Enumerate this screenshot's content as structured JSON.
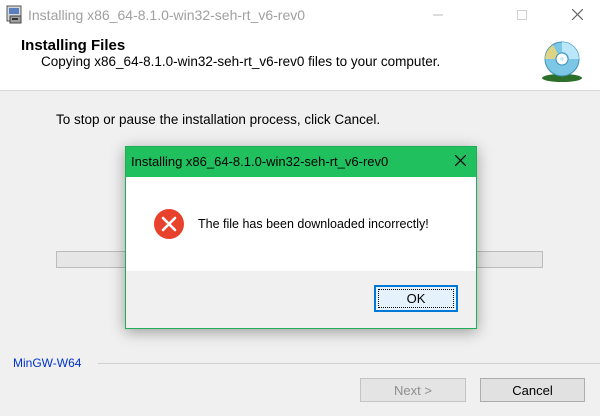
{
  "window": {
    "title": "Installing x86_64-8.1.0-win32-seh-rt_v6-rev0",
    "minimize_icon": "minimize-icon",
    "maximize_icon": "maximize-icon",
    "close_icon": "close-icon"
  },
  "header": {
    "title": "Installing Files",
    "subtitle": "Copying x86_64-8.1.0-win32-seh-rt_v6-rev0 files to your computer.",
    "icon": "install-disc-icon"
  },
  "main": {
    "instruction": "To stop or pause the installation process, click Cancel.",
    "progress": 0
  },
  "footer": {
    "brand": "MinGW-W64",
    "next_label": "Next >",
    "cancel_label": "Cancel"
  },
  "dialog": {
    "title": "Installing x86_64-8.1.0-win32-seh-rt_v6-rev0",
    "message": "The file has been downloaded incorrectly!",
    "ok_label": "OK",
    "icon": "error-icon",
    "accent": "#21c05f"
  }
}
